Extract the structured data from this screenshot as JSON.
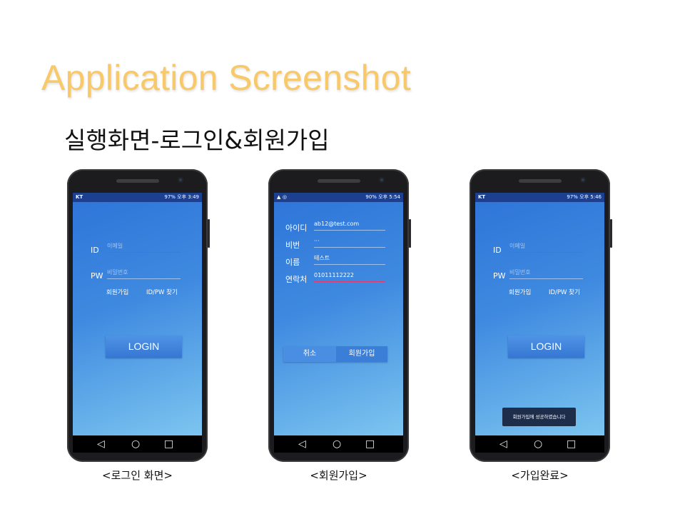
{
  "slide": {
    "title": "Application Screenshot",
    "subtitle": "실행화면-로그인&회원가입"
  },
  "phones": [
    {
      "caption": "<로그인 화면>",
      "status_left": "KT",
      "status_right": "97% 오후 3:49",
      "id_label": "ID",
      "id_placeholder": "이메일",
      "pw_label": "PW",
      "pw_placeholder": "비밀번호",
      "signup_link": "회원가입",
      "find_link": "ID/PW 찾기",
      "login_button": "LOGIN"
    },
    {
      "caption": "<회원가입>",
      "status_left": "",
      "status_right": "90% 오후 5:54",
      "fields": [
        {
          "label": "아이디",
          "value": "ab12@test.com"
        },
        {
          "label": "비번",
          "value": "···"
        },
        {
          "label": "이름",
          "value": "테스트"
        },
        {
          "label": "연락처",
          "value": "01011112222"
        }
      ],
      "cancel_button": "취소",
      "signup_button": "회원가입"
    },
    {
      "caption": "<가입완료>",
      "status_left": "KT",
      "status_right": "97% 오후 5:46",
      "id_label": "ID",
      "id_placeholder": "이메일",
      "pw_label": "PW",
      "pw_placeholder": "비밀번호",
      "signup_link": "회원가입",
      "find_link": "ID/PW 찾기",
      "login_button": "LOGIN",
      "toast": "회원가입에 성공하였습니다"
    }
  ],
  "nav_icons": [
    "back-icon",
    "home-icon",
    "recent-apps-icon"
  ],
  "colors": {
    "title": "#f7c96a",
    "screen_gradient_start": "#2d74d8",
    "screen_gradient_end": "#7cc5f0",
    "status_bar": "#1d3f8f",
    "focus_underline": "#e8386b"
  }
}
